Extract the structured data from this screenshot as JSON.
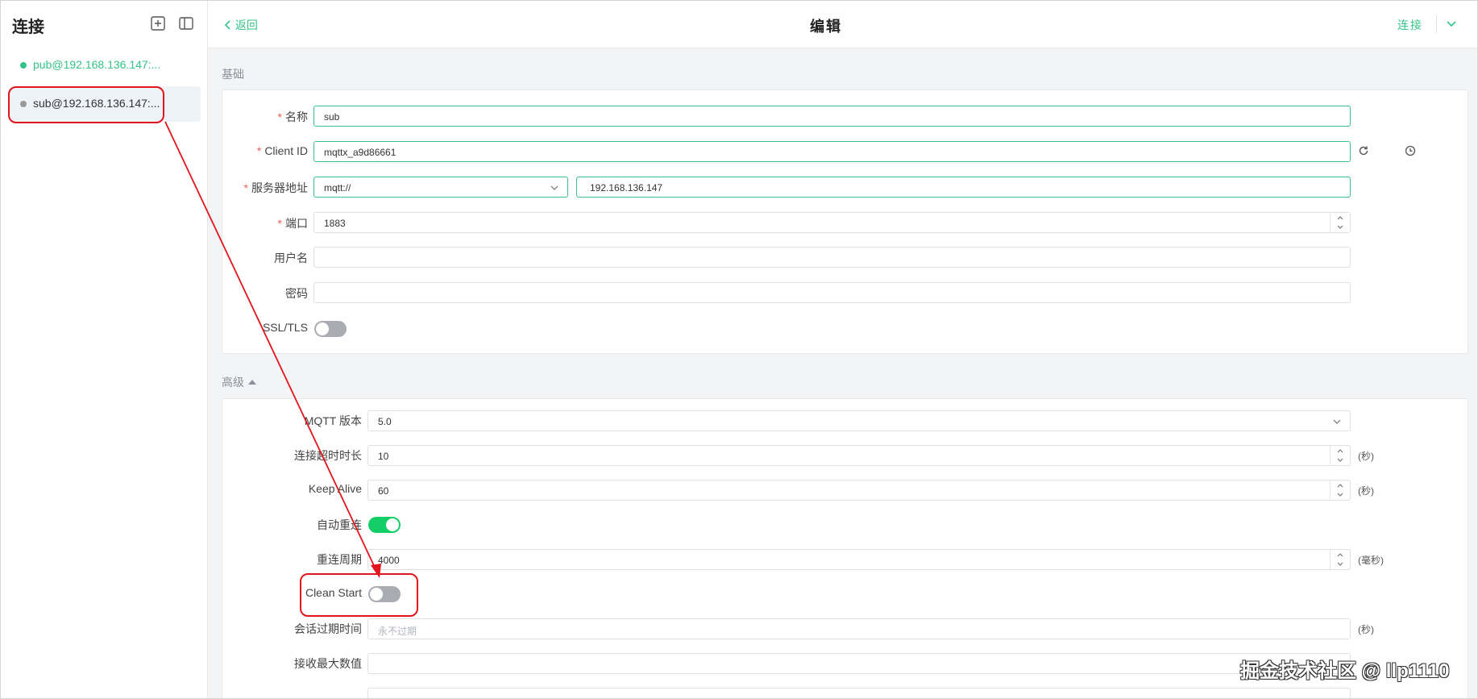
{
  "sidebar": {
    "title": "连接",
    "connections": [
      {
        "label": "pub@192.168.136.147:...",
        "status": "connected",
        "color": "#34c388"
      },
      {
        "label": "sub@192.168.136.147:...",
        "status": "disconnected",
        "color": "#999999"
      }
    ],
    "icons": [
      "add-icon",
      "sidebar-toggle-icon"
    ]
  },
  "header": {
    "back_label": "返回",
    "title": "编辑",
    "connect_label": "连接"
  },
  "basic": {
    "section_title": "基础",
    "name_label": "名称",
    "name_value": "sub",
    "client_id_label": "Client ID",
    "client_id_value": "mqttx_a9d86661",
    "host_label": "服务器地址",
    "protocol_value": "mqtt://",
    "host_value": "192.168.136.147",
    "port_label": "端口",
    "port_value": "1883",
    "username_label": "用户名",
    "username_value": "",
    "password_label": "密码",
    "password_value": "",
    "ssl_label": "SSL/TLS",
    "ssl_enabled": false
  },
  "advanced": {
    "section_title": "高级",
    "mqtt_version_label": "MQTT 版本",
    "mqtt_version_value": "5.0",
    "timeout_label": "连接超时时长",
    "timeout_value": "10",
    "timeout_unit": "(秒)",
    "keepalive_label": "Keep Alive",
    "keepalive_value": "60",
    "keepalive_unit": "(秒)",
    "auto_reconnect_label": "自动重连",
    "auto_reconnect_enabled": true,
    "reconnect_period_label": "重连周期",
    "reconnect_period_value": "4000",
    "reconnect_period_unit": "(毫秒)",
    "clean_start_label": "Clean Start",
    "clean_start_enabled": false,
    "session_expiry_label": "会话过期时间",
    "session_expiry_placeholder": "永不过期",
    "session_expiry_unit": "(秒)",
    "receive_max_label": "接收最大数值",
    "receive_max_value": ""
  },
  "watermark": "掘金技术社区 @ llp1110",
  "colors": {
    "accent": "#34c388",
    "highlight": "#e3141b",
    "toggle_on": "#13ce66",
    "toggle_off": "#a9adb3"
  }
}
